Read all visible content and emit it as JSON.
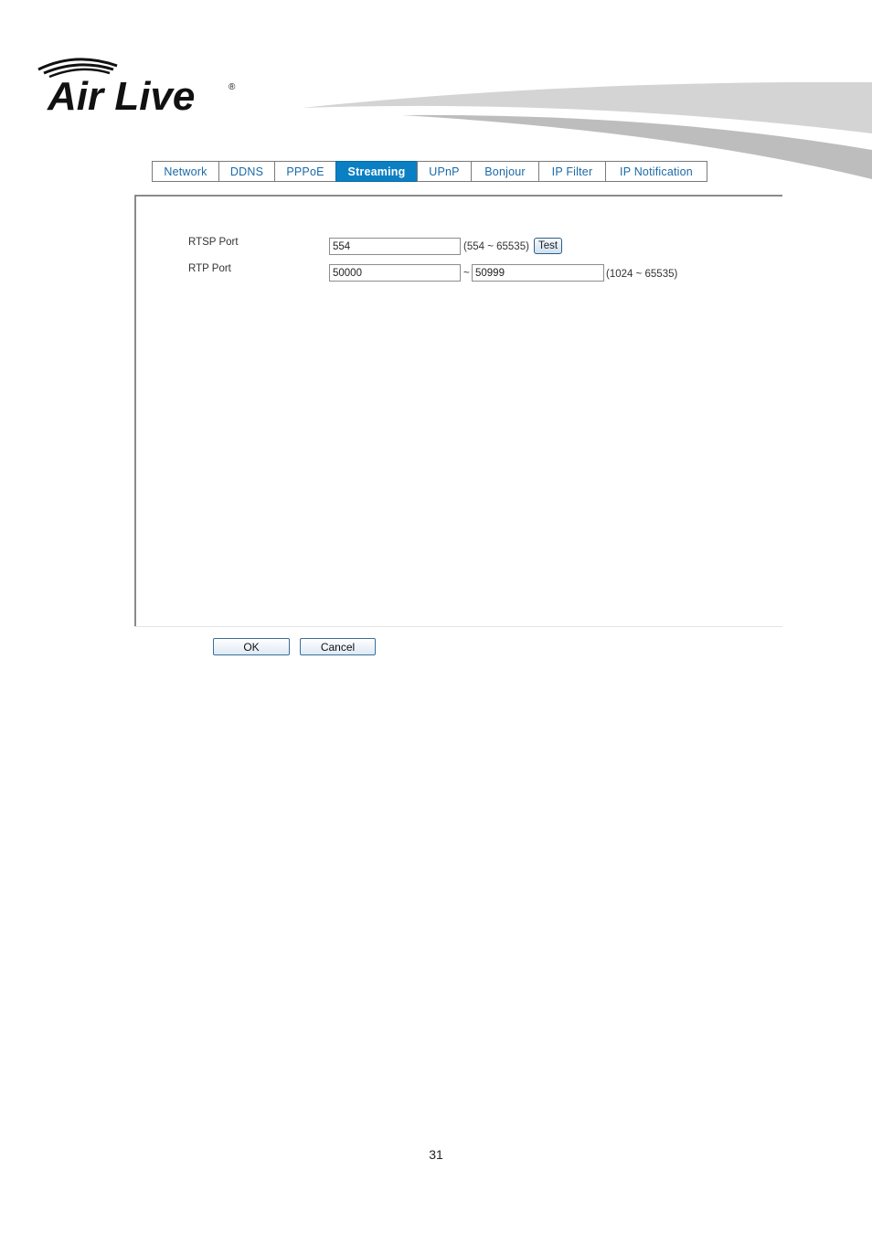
{
  "brand": {
    "name": "Air Live"
  },
  "tabs": [
    {
      "label": "Network",
      "active": false
    },
    {
      "label": "DDNS",
      "active": false
    },
    {
      "label": "PPPoE",
      "active": false
    },
    {
      "label": "Streaming",
      "active": true
    },
    {
      "label": "UPnP",
      "active": false
    },
    {
      "label": "Bonjour",
      "active": false
    },
    {
      "label": "IP Filter",
      "active": false
    },
    {
      "label": "IP Notification",
      "active": false
    }
  ],
  "form": {
    "rtsp": {
      "label": "RTSP Port",
      "value": "554",
      "range": "(554 ~ 65535)",
      "test_label": "Test"
    },
    "rtp": {
      "label": "RTP Port",
      "from": "50000",
      "separator": "~",
      "to": "50999",
      "range": "(1024 ~ 65535)"
    }
  },
  "actions": {
    "ok_label": "OK",
    "cancel_label": "Cancel"
  },
  "footer": {
    "page_number": "31"
  },
  "colors": {
    "active_tab": "#0b7fc3",
    "tab_text": "#1a6aa6"
  }
}
